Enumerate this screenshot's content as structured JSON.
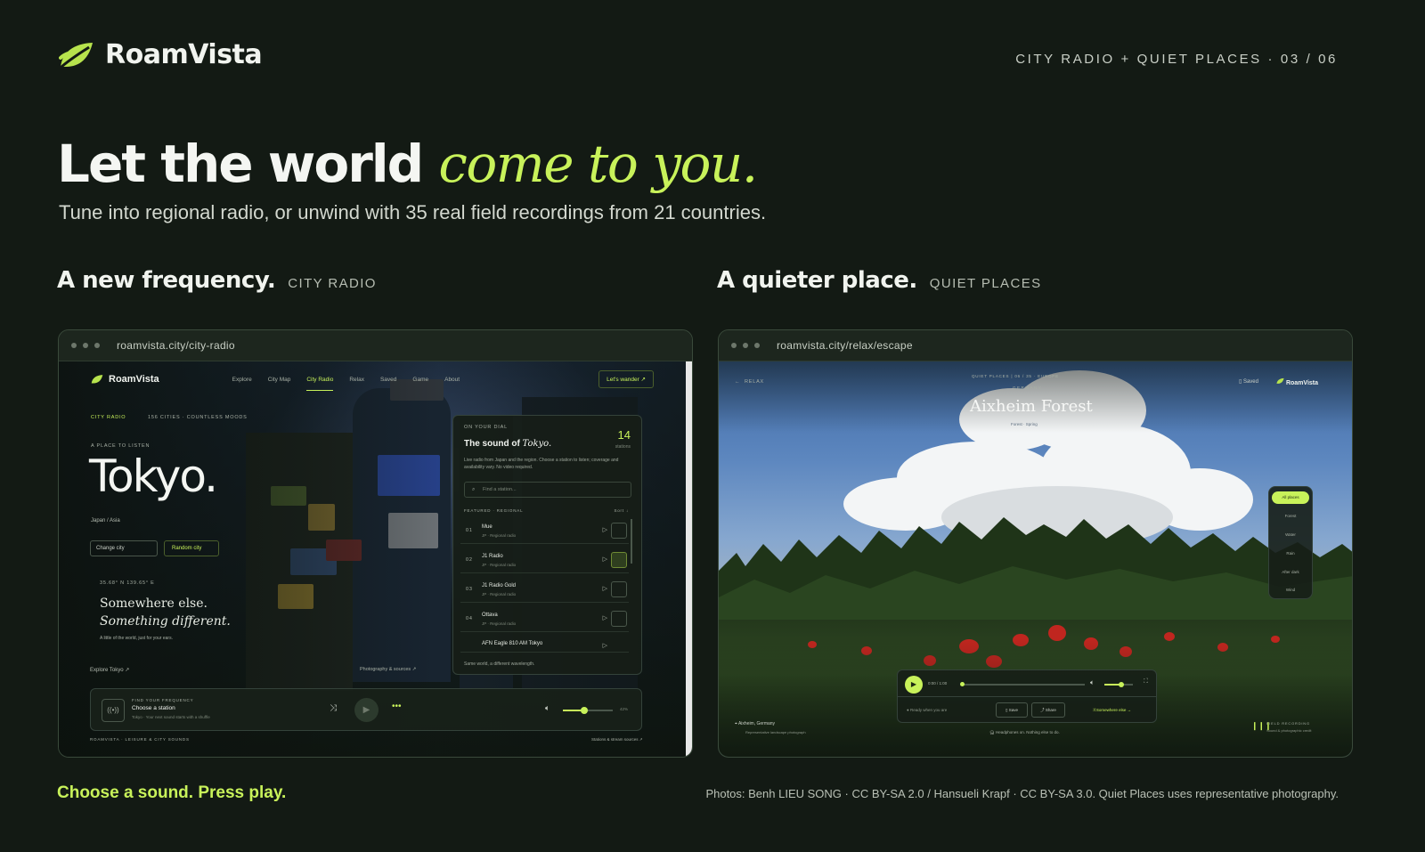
{
  "brand": {
    "name": "RoamVista"
  },
  "slide": {
    "label": "CITY RADIO + QUIET PLACES · 03 / 06"
  },
  "hero": {
    "title_plain": "Let the world ",
    "title_accent": "come to you.",
    "subtitle": "Tune into regional radio, or unwind with 35 real field recordings from 21 countries."
  },
  "sections": {
    "radio": {
      "title": "A new frequency.",
      "tag": "CITY RADIO"
    },
    "quiet": {
      "title": "A quieter place.",
      "tag": "QUIET PLACES"
    }
  },
  "radio_frame": {
    "url": "roamvista.city/city-radio",
    "nav": {
      "brand": "RoamVista",
      "links": [
        "Explore",
        "City Map",
        "City Radio",
        "Relax",
        "Saved",
        "Game",
        "About"
      ],
      "active": "City Radio",
      "cta": "Let's wander ↗"
    },
    "kicker": "CITY RADIO",
    "kicker_note": "156 CITIES · COUNTLESS MOODS",
    "eyebrow": "A PLACE TO LISTEN",
    "city": "Tokyo.",
    "location": "Japan  /  Asia",
    "change_city": "Change city",
    "random_city": "Random city",
    "coords": "35.68° N    139.65° E",
    "tagline_1": "Somewhere else.",
    "tagline_2": "Something different.",
    "tagline_note": "A little of the world, just for your ears.",
    "explore_link": "Explore Tokyo ↗",
    "photo_link": "Photography & sources ↗",
    "panel": {
      "eyebrow": "ON YOUR DIAL",
      "title_plain": "The sound of ",
      "title_accent": "Tokyo.",
      "count": "14",
      "count_label": "stations",
      "description": "Live radio from Japan and the region. Choose a station to listen; coverage and availability vary. No video required.",
      "search_placeholder": "Find a station...",
      "list_label": "FEATURED · REGIONAL",
      "list_sort": "Sort ↓",
      "stations": [
        {
          "num": "01",
          "name": "Mue",
          "sub": "JP · Regional radio"
        },
        {
          "num": "02",
          "name": "J1 Radio",
          "sub": "JP · Regional radio"
        },
        {
          "num": "03",
          "name": "J1 Radio Gold",
          "sub": "JP · Regional radio"
        },
        {
          "num": "04",
          "name": "Ottava",
          "sub": "JP · Regional radio"
        },
        {
          "num": "05",
          "name": "AFN Eagle 810 AM Tokyo",
          "sub": ""
        }
      ],
      "footer": "Same world, a different wavelength."
    },
    "player": {
      "eyebrow": "FIND YOUR FREQUENCY",
      "title": "Choose a station",
      "sub": "Tokyo · Your next sound starts with a shuffle",
      "volume_pct": 0.42,
      "volume_label": "42%"
    },
    "bottom_left": "ROAMVISTA  ·  LEISURE & CITY SOUNDS",
    "bottom_right": "Stations & stream sources ↗"
  },
  "quiet_frame": {
    "url": "roamvista.city/relax/escape",
    "back": "RELAX",
    "kicker": "QUIET PLACES  |  06 / 35 · EUROPE",
    "country": "GERMANY",
    "place": "Aixheim Forest",
    "place_tags": "Forest · Spring",
    "saved": "Saved",
    "brand": "RoamVista",
    "filters": [
      "All places",
      "Forest",
      "Water",
      "Rain",
      "After dark",
      "Wind"
    ],
    "active_filter": "All places",
    "time": "0:00 / 1:00",
    "progress": 0.0,
    "volume": 0.6,
    "ready": "Ready when you are",
    "save_label": "Save",
    "share_label": "Share",
    "elsewhere_label": "Somewhere else",
    "location": "Aixheim, Germany",
    "location_note": "Representative landscape photograph",
    "headphones": "Headphones on. Nothing else to do.",
    "field_title": "FIELD RECORDING",
    "field_sub": "Sound & photographic credit"
  },
  "footer": {
    "cta": "Choose a sound. Press play.",
    "credits": "Photos: Benh LIEU SONG · CC BY-SA 2.0 / Hansueli Krapf · CC BY-SA 3.0. Quiet Places uses representative photography."
  },
  "colors": {
    "accent": "#c8f25a",
    "background": "#131a14"
  }
}
